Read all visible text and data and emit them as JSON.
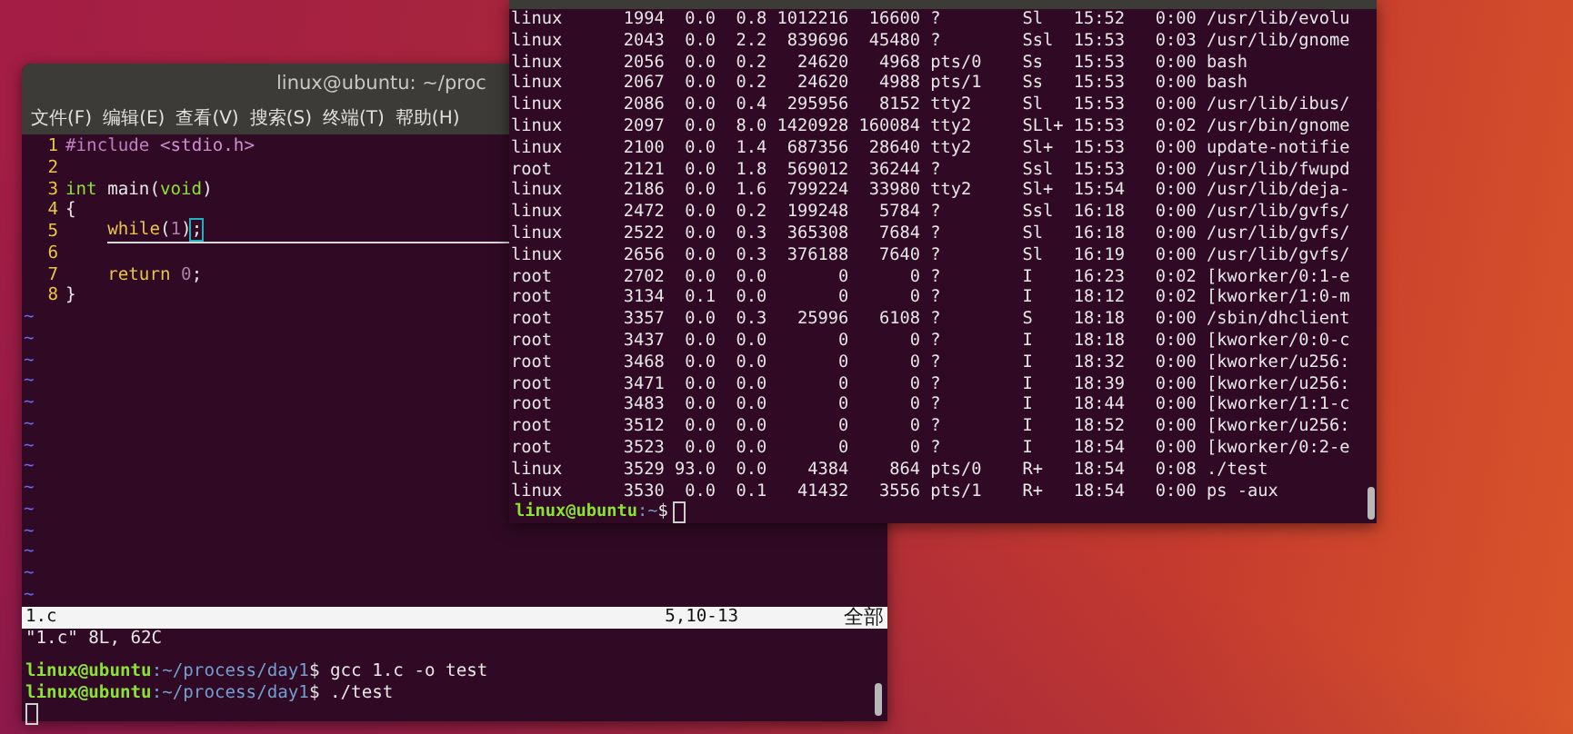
{
  "vim_window": {
    "title": "linux@ubuntu: ~/proc",
    "menu": [
      "文件(F)",
      "编辑(E)",
      "查看(V)",
      "搜索(S)",
      "终端(T)",
      "帮助(H)"
    ],
    "lines": [
      {
        "number": "1",
        "indent": false,
        "cursorline": false,
        "tokens": [
          {
            "text": "#include",
            "kind": "preproc"
          },
          {
            "text": " <stdio.h>",
            "kind": "string"
          }
        ]
      },
      {
        "number": "2",
        "cursorline": false
      },
      {
        "number": "3",
        "indent": false,
        "cursorline": false,
        "tokens": [
          {
            "text": "int",
            "kind": "type"
          },
          {
            "text": " main(",
            "kind": "plain"
          },
          {
            "text": "void",
            "kind": "type"
          },
          {
            "text": ")",
            "kind": "plain"
          }
        ]
      },
      {
        "number": "4",
        "indent": false,
        "cursorline": false,
        "tokens": [
          {
            "text": "{",
            "kind": "plain"
          }
        ]
      },
      {
        "number": "5",
        "indent": true,
        "cursorline": true,
        "tokens": [
          {
            "text": "while",
            "kind": "keyword"
          },
          {
            "text": "(",
            "kind": "plain"
          },
          {
            "text": "1",
            "kind": "number"
          },
          {
            "text": ")",
            "kind": "plain"
          },
          {
            "text": ";",
            "kind": "cursor"
          }
        ]
      },
      {
        "number": "6",
        "cursorline": false
      },
      {
        "number": "7",
        "indent": true,
        "cursorline": false,
        "tokens": [
          {
            "text": "return",
            "kind": "keyword"
          },
          {
            "text": " 0",
            "kind": "number"
          },
          {
            "text": ";",
            "kind": "plain"
          }
        ]
      },
      {
        "number": "8",
        "indent": false,
        "cursorline": false,
        "tokens": [
          {
            "text": "}",
            "kind": "plain"
          }
        ]
      }
    ],
    "empty_lines": [
      "~",
      "~",
      "~",
      "~",
      "~",
      "~",
      "~",
      "~",
      "~",
      "~",
      "~",
      "~",
      "~",
      "~"
    ],
    "status": {
      "file": "1.c",
      "position": "5,10-13",
      "scope": "全部"
    },
    "message": "\"1.c\" 8L, 62C",
    "shell_lines": [
      {
        "user": "linux@ubuntu",
        "path": ":~/process/day1",
        "command": "$ gcc 1.c -o test"
      },
      {
        "user": "linux@ubuntu",
        "path": ":~/process/day1",
        "command": "$ ./test"
      }
    ]
  },
  "ps_window": {
    "rows": [
      "linux      1994  0.0  0.8 1012216  16600 ?        Sl   15:52   0:00 /usr/lib/evolu",
      "linux      2043  0.0  2.2  839696  45480 ?        Ssl  15:53   0:03 /usr/lib/gnome",
      "linux      2056  0.0  0.2   24620   4968 pts/0    Ss   15:53   0:00 bash",
      "linux      2067  0.0  0.2   24620   4988 pts/1    Ss   15:53   0:00 bash",
      "linux      2086  0.0  0.4  295956   8152 tty2     Sl   15:53   0:00 /usr/lib/ibus/",
      "linux      2097  0.0  8.0 1420928 160084 tty2     SLl+ 15:53   0:02 /usr/bin/gnome",
      "linux      2100  0.0  1.4  687356  28640 tty2     Sl+  15:53   0:00 update-notifie",
      "root       2121  0.0  1.8  569012  36244 ?        Ssl  15:53   0:00 /usr/lib/fwupd",
      "linux      2186  0.0  1.6  799224  33980 tty2     Sl+  15:54   0:00 /usr/lib/deja-",
      "linux      2472  0.0  0.2  199248   5784 ?        Ssl  16:18   0:00 /usr/lib/gvfs/",
      "linux      2522  0.0  0.3  365308   7684 ?        Sl   16:18   0:00 /usr/lib/gvfs/",
      "linux      2656  0.0  0.3  376188   7640 ?        Sl   16:19   0:00 /usr/lib/gvfs/",
      "root       2702  0.0  0.0       0      0 ?        I    16:23   0:02 [kworker/0:1-e",
      "root       3134  0.1  0.0       0      0 ?        I    18:12   0:02 [kworker/1:0-m",
      "root       3357  0.0  0.3   25996   6108 ?        S    18:18   0:00 /sbin/dhclient",
      "root       3437  0.0  0.0       0      0 ?        I    18:18   0:00 [kworker/0:0-c",
      "root       3468  0.0  0.0       0      0 ?        I    18:32   0:00 [kworker/u256:",
      "root       3471  0.0  0.0       0      0 ?        I    18:39   0:00 [kworker/u256:",
      "root       3483  0.0  0.0       0      0 ?        I    18:44   0:00 [kworker/1:1-c",
      "root       3512  0.0  0.0       0      0 ?        I    18:52   0:00 [kworker/u256:",
      "root       3523  0.0  0.0       0      0 ?        I    18:54   0:00 [kworker/0:2-e",
      "linux      3529 93.0  0.0    4384    864 pts/0    R+   18:54   0:08 ./test",
      "linux      3530  0.0  0.1   41432   3556 pts/1    R+   18:54   0:00 ps -aux"
    ],
    "prompt": {
      "user": "linux@ubuntu",
      "path": ":~",
      "command": "$"
    }
  }
}
